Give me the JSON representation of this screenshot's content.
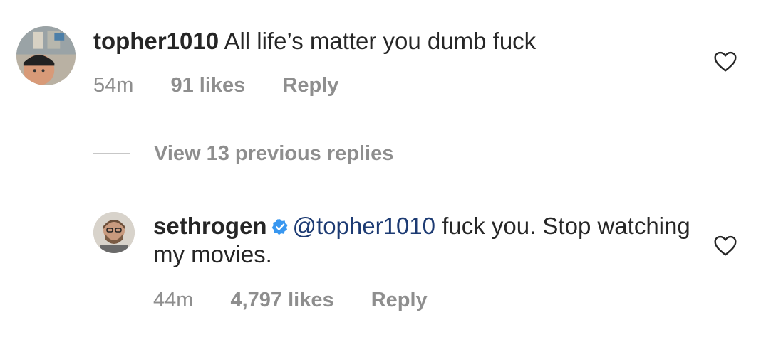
{
  "comments": [
    {
      "username": "topher1010",
      "text": "All life’s matter you dumb fuck",
      "time": "54m",
      "likes": "91 likes",
      "reply": "Reply"
    },
    {
      "username": "sethrogen",
      "mention": "@topher1010",
      "text": "fuck you. Stop watching my movies.",
      "time": "44m",
      "likes": "4,797 likes",
      "reply": "Reply"
    }
  ],
  "thread": {
    "view_replies": "View 13 previous replies"
  },
  "icons": {
    "like": "heart-outline-icon",
    "verified": "verified-badge-icon"
  },
  "colors": {
    "text": "#262626",
    "secondary": "#8e8e8e",
    "mention": "#1d3b73",
    "verified": "#3897f0"
  }
}
